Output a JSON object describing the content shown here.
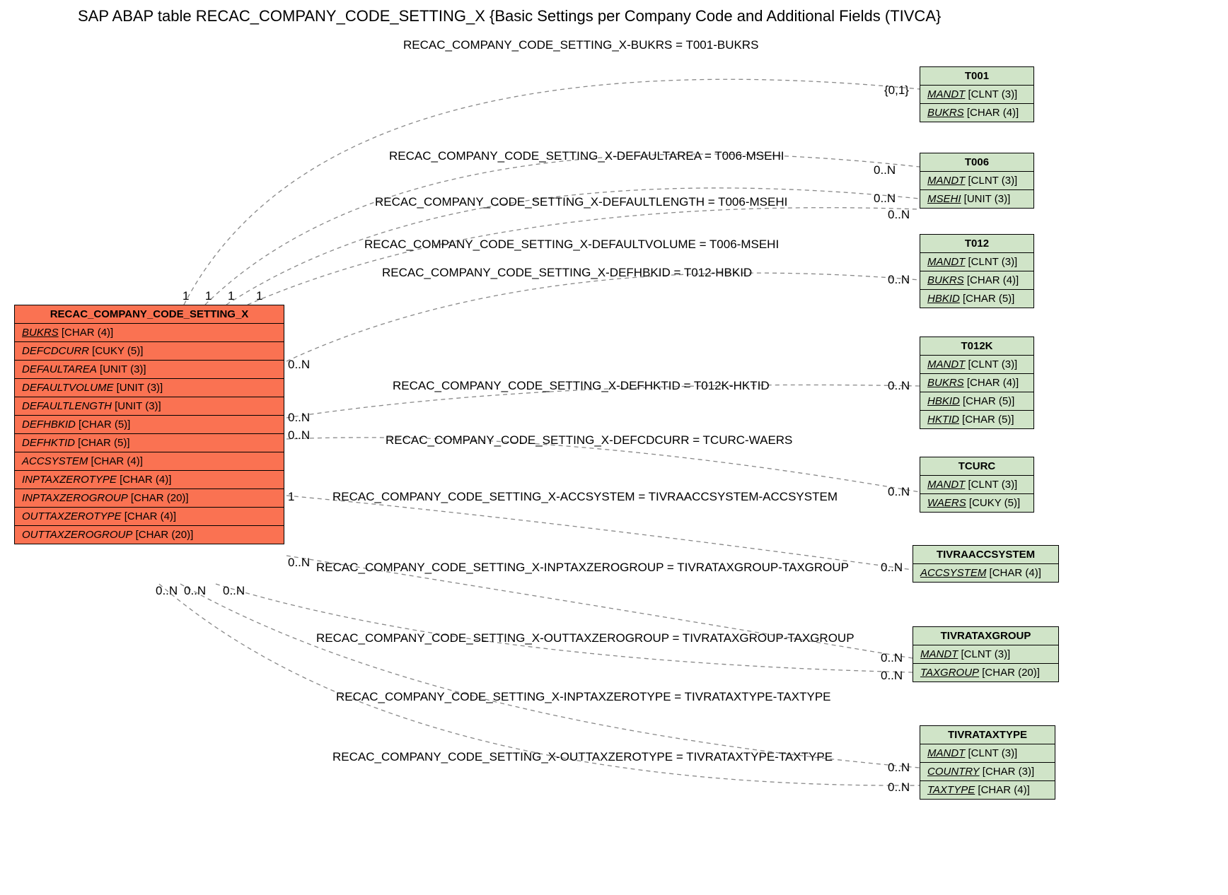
{
  "title": "SAP ABAP table RECAC_COMPANY_CODE_SETTING_X {Basic Settings per Company Code and Additional Fields (TIVCA}",
  "main": {
    "name": "RECAC_COMPANY_CODE_SETTING_X",
    "fields": [
      {
        "n": "BUKRS",
        "t": "[CHAR (4)]",
        "u": 1
      },
      {
        "n": "DEFCDCURR",
        "t": "[CUKY (5)]",
        "u": 0
      },
      {
        "n": "DEFAULTAREA",
        "t": "[UNIT (3)]",
        "u": 0
      },
      {
        "n": "DEFAULTVOLUME",
        "t": "[UNIT (3)]",
        "u": 0
      },
      {
        "n": "DEFAULTLENGTH",
        "t": "[UNIT (3)]",
        "u": 0
      },
      {
        "n": "DEFHBKID",
        "t": "[CHAR (5)]",
        "u": 0
      },
      {
        "n": "DEFHKTID",
        "t": "[CHAR (5)]",
        "u": 0
      },
      {
        "n": "ACCSYSTEM",
        "t": "[CHAR (4)]",
        "u": 0
      },
      {
        "n": "INPTAXZEROTYPE",
        "t": "[CHAR (4)]",
        "u": 0
      },
      {
        "n": "INPTAXZEROGROUP",
        "t": "[CHAR (20)]",
        "u": 0
      },
      {
        "n": "OUTTAXZEROTYPE",
        "t": "[CHAR (4)]",
        "u": 0
      },
      {
        "n": "OUTTAXZEROGROUP",
        "t": "[CHAR (20)]",
        "u": 0
      }
    ]
  },
  "refs": [
    {
      "name": "T001",
      "fields": [
        {
          "n": "MANDT",
          "t": "[CLNT (3)]",
          "u": 1
        },
        {
          "n": "BUKRS",
          "t": "[CHAR (4)]",
          "u": 1
        }
      ]
    },
    {
      "name": "T006",
      "fields": [
        {
          "n": "MANDT",
          "t": "[CLNT (3)]",
          "u": 1
        },
        {
          "n": "MSEHI",
          "t": "[UNIT (3)]",
          "u": 1
        }
      ]
    },
    {
      "name": "T012",
      "fields": [
        {
          "n": "MANDT",
          "t": "[CLNT (3)]",
          "u": 1
        },
        {
          "n": "BUKRS",
          "t": "[CHAR (4)]",
          "u": 1
        },
        {
          "n": "HBKID",
          "t": "[CHAR (5)]",
          "u": 1
        }
      ]
    },
    {
      "name": "T012K",
      "fields": [
        {
          "n": "MANDT",
          "t": "[CLNT (3)]",
          "u": 1
        },
        {
          "n": "BUKRS",
          "t": "[CHAR (4)]",
          "u": 1
        },
        {
          "n": "HBKID",
          "t": "[CHAR (5)]",
          "u": 1
        },
        {
          "n": "HKTID",
          "t": "[CHAR (5)]",
          "u": 1
        }
      ]
    },
    {
      "name": "TCURC",
      "fields": [
        {
          "n": "MANDT",
          "t": "[CLNT (3)]",
          "u": 1
        },
        {
          "n": "WAERS",
          "t": "[CUKY (5)]",
          "u": 1
        }
      ]
    },
    {
      "name": "TIVRAACCSYSTEM",
      "fields": [
        {
          "n": "ACCSYSTEM",
          "t": "[CHAR (4)]",
          "u": 1
        }
      ]
    },
    {
      "name": "TIVRATAXGROUP",
      "fields": [
        {
          "n": "MANDT",
          "t": "[CLNT (3)]",
          "u": 1
        },
        {
          "n": "TAXGROUP",
          "t": "[CHAR (20)]",
          "u": 1
        }
      ]
    },
    {
      "name": "TIVRATAXTYPE",
      "fields": [
        {
          "n": "MANDT",
          "t": "[CLNT (3)]",
          "u": 1
        },
        {
          "n": "COUNTRY",
          "t": "[CHAR (3)]",
          "u": 1
        },
        {
          "n": "TAXTYPE",
          "t": "[CHAR (4)]",
          "u": 1
        }
      ]
    }
  ],
  "edge_labels": [
    "RECAC_COMPANY_CODE_SETTING_X-BUKRS = T001-BUKRS",
    "RECAC_COMPANY_CODE_SETTING_X-DEFAULTAREA = T006-MSEHI",
    "RECAC_COMPANY_CODE_SETTING_X-DEFAULTLENGTH = T006-MSEHI",
    "RECAC_COMPANY_CODE_SETTING_X-DEFAULTVOLUME = T006-MSEHI",
    "RECAC_COMPANY_CODE_SETTING_X-DEFHBKID = T012-HBKID",
    "RECAC_COMPANY_CODE_SETTING_X-DEFHKTID = T012K-HKTID",
    "RECAC_COMPANY_CODE_SETTING_X-DEFCDCURR = TCURC-WAERS",
    "RECAC_COMPANY_CODE_SETTING_X-ACCSYSTEM = TIVRAACCSYSTEM-ACCSYSTEM",
    "RECAC_COMPANY_CODE_SETTING_X-INPTAXZEROGROUP = TIVRATAXGROUP-TAXGROUP",
    "RECAC_COMPANY_CODE_SETTING_X-OUTTAXZEROGROUP = TIVRATAXGROUP-TAXGROUP",
    "RECAC_COMPANY_CODE_SETTING_X-INPTAXZEROTYPE = TIVRATAXTYPE-TAXTYPE",
    "RECAC_COMPANY_CODE_SETTING_X-OUTTAXZEROTYPE = TIVRATAXTYPE-TAXTYPE"
  ],
  "cards": {
    "left_top": [
      "1",
      "1",
      "1",
      "1"
    ],
    "right_main": [
      "0..N",
      "0..N",
      "0..N",
      "1",
      "0..N"
    ],
    "bottom_main": [
      "0..N",
      "0..N",
      "0..N"
    ],
    "t001": "{0,1}",
    "t006": [
      "0..N",
      "0..N",
      "0..N"
    ],
    "t012": "0..N",
    "t012k": "0..N",
    "tcurc": "0..N",
    "tivraacc": "0..N",
    "taxgroup": [
      "0..N",
      "0..N"
    ],
    "taxtype": [
      "0..N",
      "0..N"
    ]
  }
}
